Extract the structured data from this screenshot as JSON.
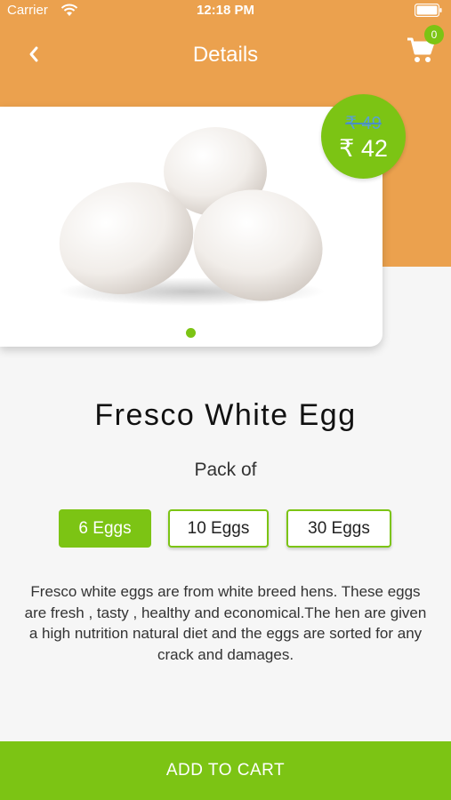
{
  "status_bar": {
    "carrier": "Carrier",
    "time": "12:18 PM"
  },
  "nav": {
    "title": "Details",
    "cart_count": "0"
  },
  "icons": {
    "back": "chevron-left-icon",
    "cart": "cart-icon",
    "wifi": "wifi-icon",
    "battery": "battery-icon"
  },
  "price": {
    "original": "₹ 49",
    "current": "₹ 42"
  },
  "product": {
    "name": "Fresco White Egg",
    "pack_label": "Pack of",
    "options": [
      {
        "label": "6 Eggs",
        "selected": true
      },
      {
        "label": "10 Eggs",
        "selected": false
      },
      {
        "label": "30 Eggs",
        "selected": false
      }
    ],
    "description": "Fresco white eggs are from white breed hens. These eggs are fresh , tasty , healthy and economical.The hen are given a high nutrition natural diet and the eggs are sorted for any crack and damages."
  },
  "carousel": {
    "count": 1,
    "active": 1
  },
  "actions": {
    "add_to_cart": "ADD TO CART"
  },
  "colors": {
    "header": "#eba14e",
    "accent": "#7cc414",
    "background": "#f6f6f6"
  }
}
